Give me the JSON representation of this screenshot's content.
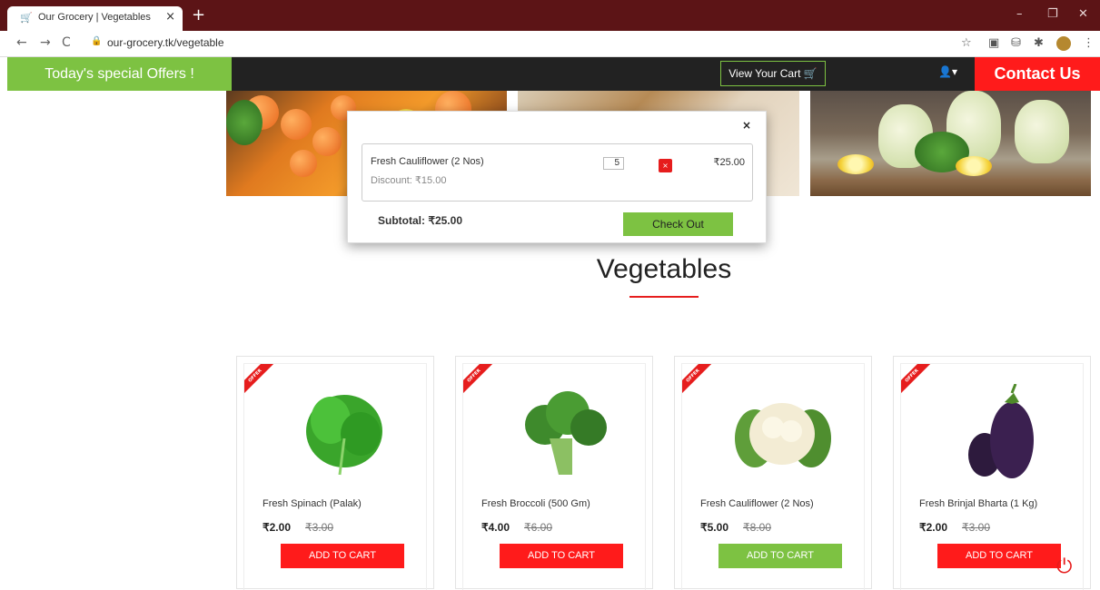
{
  "browser": {
    "tab_title": "Our Grocery | Vegetables",
    "url": "our-grocery.tk/vegetable"
  },
  "header": {
    "offers_label": "Today's special Offers !",
    "view_cart_label": "View Your Cart",
    "contact_label": "Contact Us"
  },
  "cart": {
    "item_name": "Fresh Cauliflower (2 Nos)",
    "item_discount": "Discount: ₹15.00",
    "item_qty": "5",
    "item_price": "₹25.00",
    "remove_label": "×",
    "subtotal": "Subtotal: ₹25.00",
    "checkout_label": "Check Out"
  },
  "section": {
    "title": "Vegetables"
  },
  "products": [
    {
      "ribbon": "OFFER",
      "name": "Fresh Spinach (Palak)",
      "price": "₹2.00",
      "old_price": "₹3.00",
      "button": "ADD TO CART",
      "button_state": "red"
    },
    {
      "ribbon": "OFFER",
      "name": "Fresh Broccoli (500 Gm)",
      "price": "₹4.00",
      "old_price": "₹6.00",
      "button": "ADD TO CART",
      "button_state": "red"
    },
    {
      "ribbon": "OFFER",
      "name": "Fresh Cauliflower (2 Nos)",
      "price": "₹5.00",
      "old_price": "₹8.00",
      "button": "ADD TO CART",
      "button_state": "green"
    },
    {
      "ribbon": "OFFER",
      "name": "Fresh Brinjal Bharta (1 Kg)",
      "price": "₹2.00",
      "old_price": "₹3.00",
      "button": "ADD TO CART",
      "button_state": "red"
    }
  ],
  "colors": {
    "brand_green": "#7dc242",
    "brand_red": "#ff1b1b",
    "header_dark": "#222222",
    "tabbar": "#5c1416"
  },
  "icons": [
    "cart-icon",
    "close-icon",
    "back-icon",
    "forward-icon",
    "reload-icon",
    "lock-icon",
    "star-icon",
    "user-icon",
    "scroll-top-icon"
  ]
}
